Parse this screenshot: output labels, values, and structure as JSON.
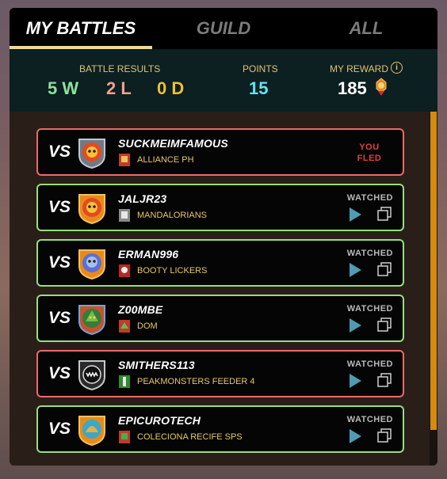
{
  "tabs": [
    {
      "label": "MY BATTLES",
      "active": true
    },
    {
      "label": "GUILD",
      "active": false
    },
    {
      "label": "ALL",
      "active": false
    }
  ],
  "summary": {
    "results_label": "BATTLE RESULTS",
    "wins": "5 W",
    "losses": "2 L",
    "draws": "0 D",
    "points_label": "POINTS",
    "points": "15",
    "reward_label": "MY REWARD",
    "reward": "185",
    "reward_icon": "dec-token-icon",
    "info_icon": "info-icon"
  },
  "colors": {
    "win_border": "#95e07f",
    "loss_border": "#ec6a68",
    "accent": "#f1d79a",
    "gold": "#e4c36c",
    "scroll": "#d68b0f"
  },
  "battles": [
    {
      "vs": "VS",
      "opponent": "SUCKMEIMFAMOUS",
      "guild": "ALLIANCE PH",
      "result": "loss",
      "status": "YOU FLED",
      "avatar": "fire-skull-avatar",
      "guild_icon": "red-banner-icon"
    },
    {
      "vs": "VS",
      "opponent": "JALJR23",
      "guild": "MANDALORIANS",
      "result": "win",
      "status": "WATCHED",
      "avatar": "fire-skull-avatar",
      "guild_icon": "grey-banner-icon"
    },
    {
      "vs": "VS",
      "opponent": "ERMAN996",
      "guild": "BOOTY LICKERS",
      "result": "win",
      "status": "WATCHED",
      "avatar": "undead-avatar",
      "guild_icon": "skull-banner-icon"
    },
    {
      "vs": "VS",
      "opponent": "Z00MBE",
      "guild": "DOM",
      "result": "win",
      "status": "WATCHED",
      "avatar": "dragon-avatar",
      "guild_icon": "red-banner-icon"
    },
    {
      "vs": "VS",
      "opponent": "SMITHERS113",
      "guild": "PEAKMONSTERS FEEDER 4",
      "result": "loss",
      "status": "WATCHED",
      "avatar": "monster-mouth-avatar",
      "guild_icon": "green-banner-icon"
    },
    {
      "vs": "VS",
      "opponent": "EPICUROTECH",
      "guild": "COLECIONA RECIFE SPS",
      "result": "win",
      "status": "WATCHED",
      "avatar": "desert-avatar",
      "guild_icon": "red-banner-icon"
    }
  ]
}
